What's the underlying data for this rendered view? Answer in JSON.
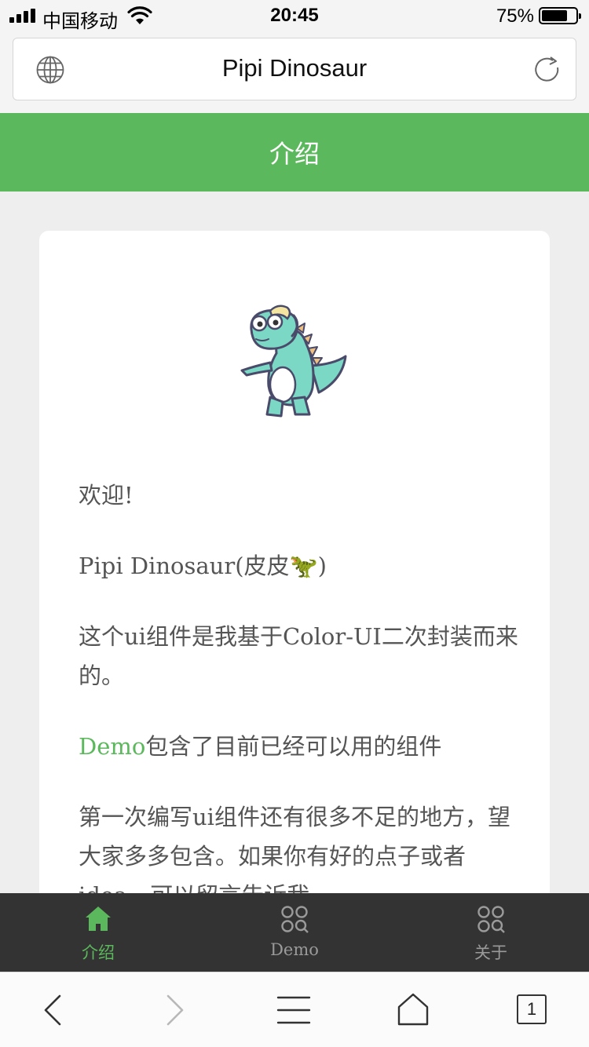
{
  "status_bar": {
    "carrier": "中国移动",
    "time": "20:45",
    "battery_percent": "75%",
    "battery_level": 0.75
  },
  "browser": {
    "page_title": "Pipi Dinosaur",
    "open_tabs": "1"
  },
  "header": {
    "title": "介绍"
  },
  "card": {
    "paragraphs": {
      "welcome": "欢迎!",
      "name": "Pipi Dinosaur(皮皮🦖)",
      "intro": "这个ui组件是我基于Color-UI二次封装而来的。",
      "demo_link": "Demo",
      "demo_rest": "包含了目前已经可以用的组件",
      "feedback": "第一次编写ui组件还有很多不足的地方，望大家多多包含。如果你有好的点子或者idea，可以留言告诉我。"
    }
  },
  "tab_bar": {
    "items": [
      {
        "label": "介绍",
        "icon": "home-icon",
        "active": true
      },
      {
        "label": "Demo",
        "icon": "grid-search-icon",
        "active": false
      },
      {
        "label": "关于",
        "icon": "grid-search-icon",
        "active": false
      }
    ]
  },
  "colors": {
    "accent_green": "#5cb85c",
    "tab_bar_bg": "#333333",
    "page_bg": "#eeeeee"
  }
}
